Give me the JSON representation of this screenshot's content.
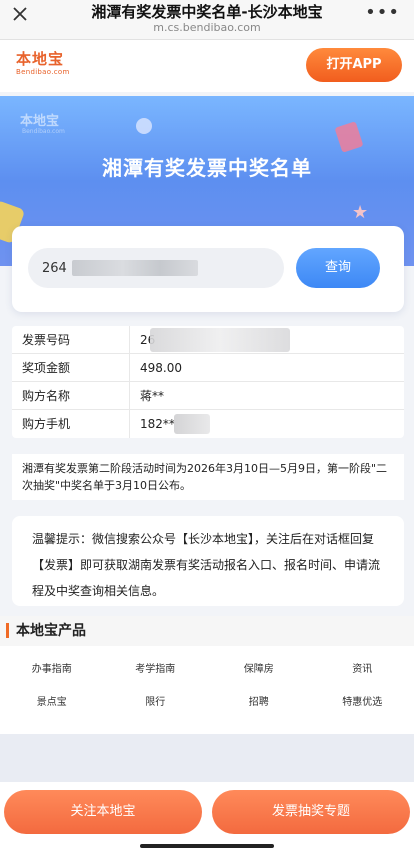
{
  "browser": {
    "title": "湘潭有奖发票中奖名单-长沙本地宝",
    "url": "m.cs.bendibao.com",
    "more": "•••"
  },
  "header": {
    "logo_cn": "本地宝",
    "logo_en": "Bendibao.com",
    "open_app": "打开APP"
  },
  "hero": {
    "watermark_cn": "本地宝",
    "watermark_en": "Bendibao.com",
    "title": "湘潭有奖发票中奖名单"
  },
  "search": {
    "value": "264",
    "button": "查询"
  },
  "result": {
    "rows": [
      {
        "key": "发票号码",
        "value": "26"
      },
      {
        "key": "奖项金额",
        "value": "498.00"
      },
      {
        "key": "购方名称",
        "value": "蒋**"
      },
      {
        "key": "购方手机",
        "value": "182****"
      }
    ]
  },
  "notice": "湘潭有奖发票第二阶段活动时间为2026年3月10日—5月9日，第一阶段\"二次抽奖\"中奖名单于3月10日公布。",
  "tip": "温馨提示：微信搜索公众号【长沙本地宝】，关注后在对话框回复【发票】即可获取湖南发票有奖活动报名入口、报名时间、申请流程及中奖查询相关信息。",
  "products": {
    "title": "本地宝产品",
    "items": [
      "办事指南",
      "考学指南",
      "保障房",
      "资讯",
      "景点宝",
      "限行",
      "招聘",
      "特惠优选"
    ]
  },
  "bottom": {
    "follow": "关注本地宝",
    "lottery": "发票抽奖专题"
  },
  "colors": {
    "accent": "#f15d1e",
    "primary_blue": "#3d88f5"
  }
}
